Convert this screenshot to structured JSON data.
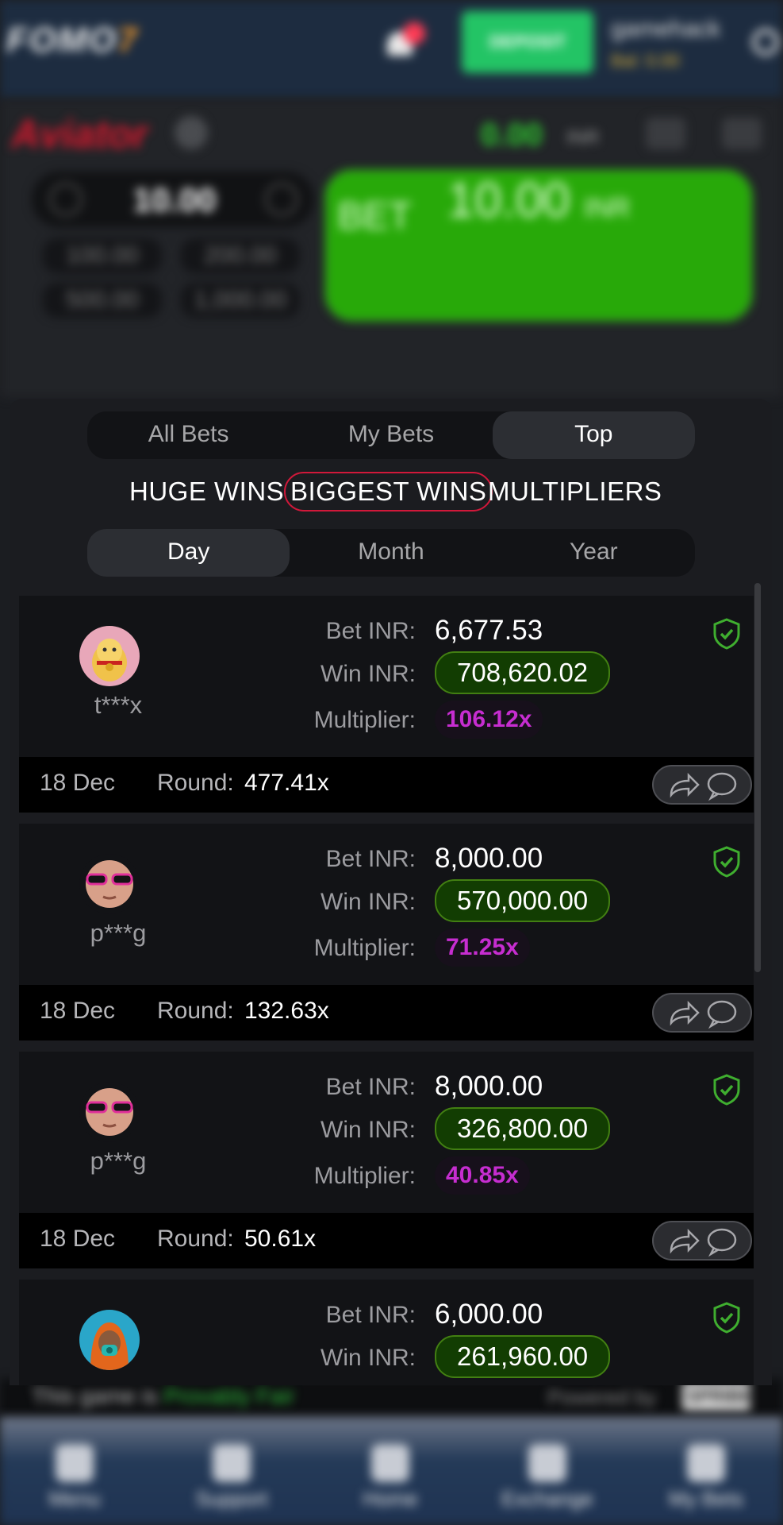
{
  "site": {
    "logo": "FOMO",
    "logo_accent": "7",
    "deposit_label": "DEPOSIT",
    "username": "gamehack",
    "balance": "Bal: 0.00",
    "notification_count": "1"
  },
  "game": {
    "title": "Aviator",
    "balance": "0.00",
    "currency": "INR",
    "stake": "10.00",
    "quick_amounts": [
      "100.00",
      "200.00",
      "500.00",
      "1,000.00"
    ],
    "bet_label": "BET",
    "bet_amount": "10.00",
    "bet_currency": "INR"
  },
  "tabs": [
    "All Bets",
    "My Bets",
    "Top"
  ],
  "active_tab": "Top",
  "categories": [
    "HUGE WINS",
    "BIGGEST WINS",
    "MULTIPLIERS"
  ],
  "selected_category": "BIGGEST WINS",
  "periods": [
    "Day",
    "Month",
    "Year"
  ],
  "active_period": "Day",
  "labels": {
    "bet": "Bet INR:",
    "win": "Win INR:",
    "multiplier": "Multiplier:",
    "round": "Round:"
  },
  "bets": [
    {
      "user": "t***x",
      "avatar": "lucky-cat-avatar",
      "bet": "6,677.53",
      "win": "708,620.02",
      "multiplier": "106.12x",
      "date": "18 Dec",
      "round": "477.41x"
    },
    {
      "user": "p***g",
      "avatar": "baby-sunglasses-avatar",
      "bet": "8,000.00",
      "win": "570,000.00",
      "multiplier": "71.25x",
      "date": "18 Dec",
      "round": "132.63x"
    },
    {
      "user": "p***g",
      "avatar": "baby-sunglasses-avatar",
      "bet": "8,000.00",
      "win": "326,800.00",
      "multiplier": "40.85x",
      "date": "18 Dec",
      "round": "50.61x"
    },
    {
      "user": "",
      "avatar": "gas-mask-avatar",
      "bet": "6,000.00",
      "win": "261,960.00",
      "multiplier": "",
      "date": "",
      "round": ""
    }
  ],
  "footer": {
    "fair_prefix": "This game is",
    "fair_label": "Provably Fair",
    "powered_by": "Powered by",
    "provider": "SPRIBE"
  },
  "bottom_nav": [
    "Menu",
    "Support",
    "Home",
    "Exchange",
    "My Bets"
  ],
  "colors": {
    "win_green": "#123d02",
    "multiplier_purple": "#c62dd0",
    "category_ring": "#d1183a",
    "bet_button": "#28a909"
  }
}
